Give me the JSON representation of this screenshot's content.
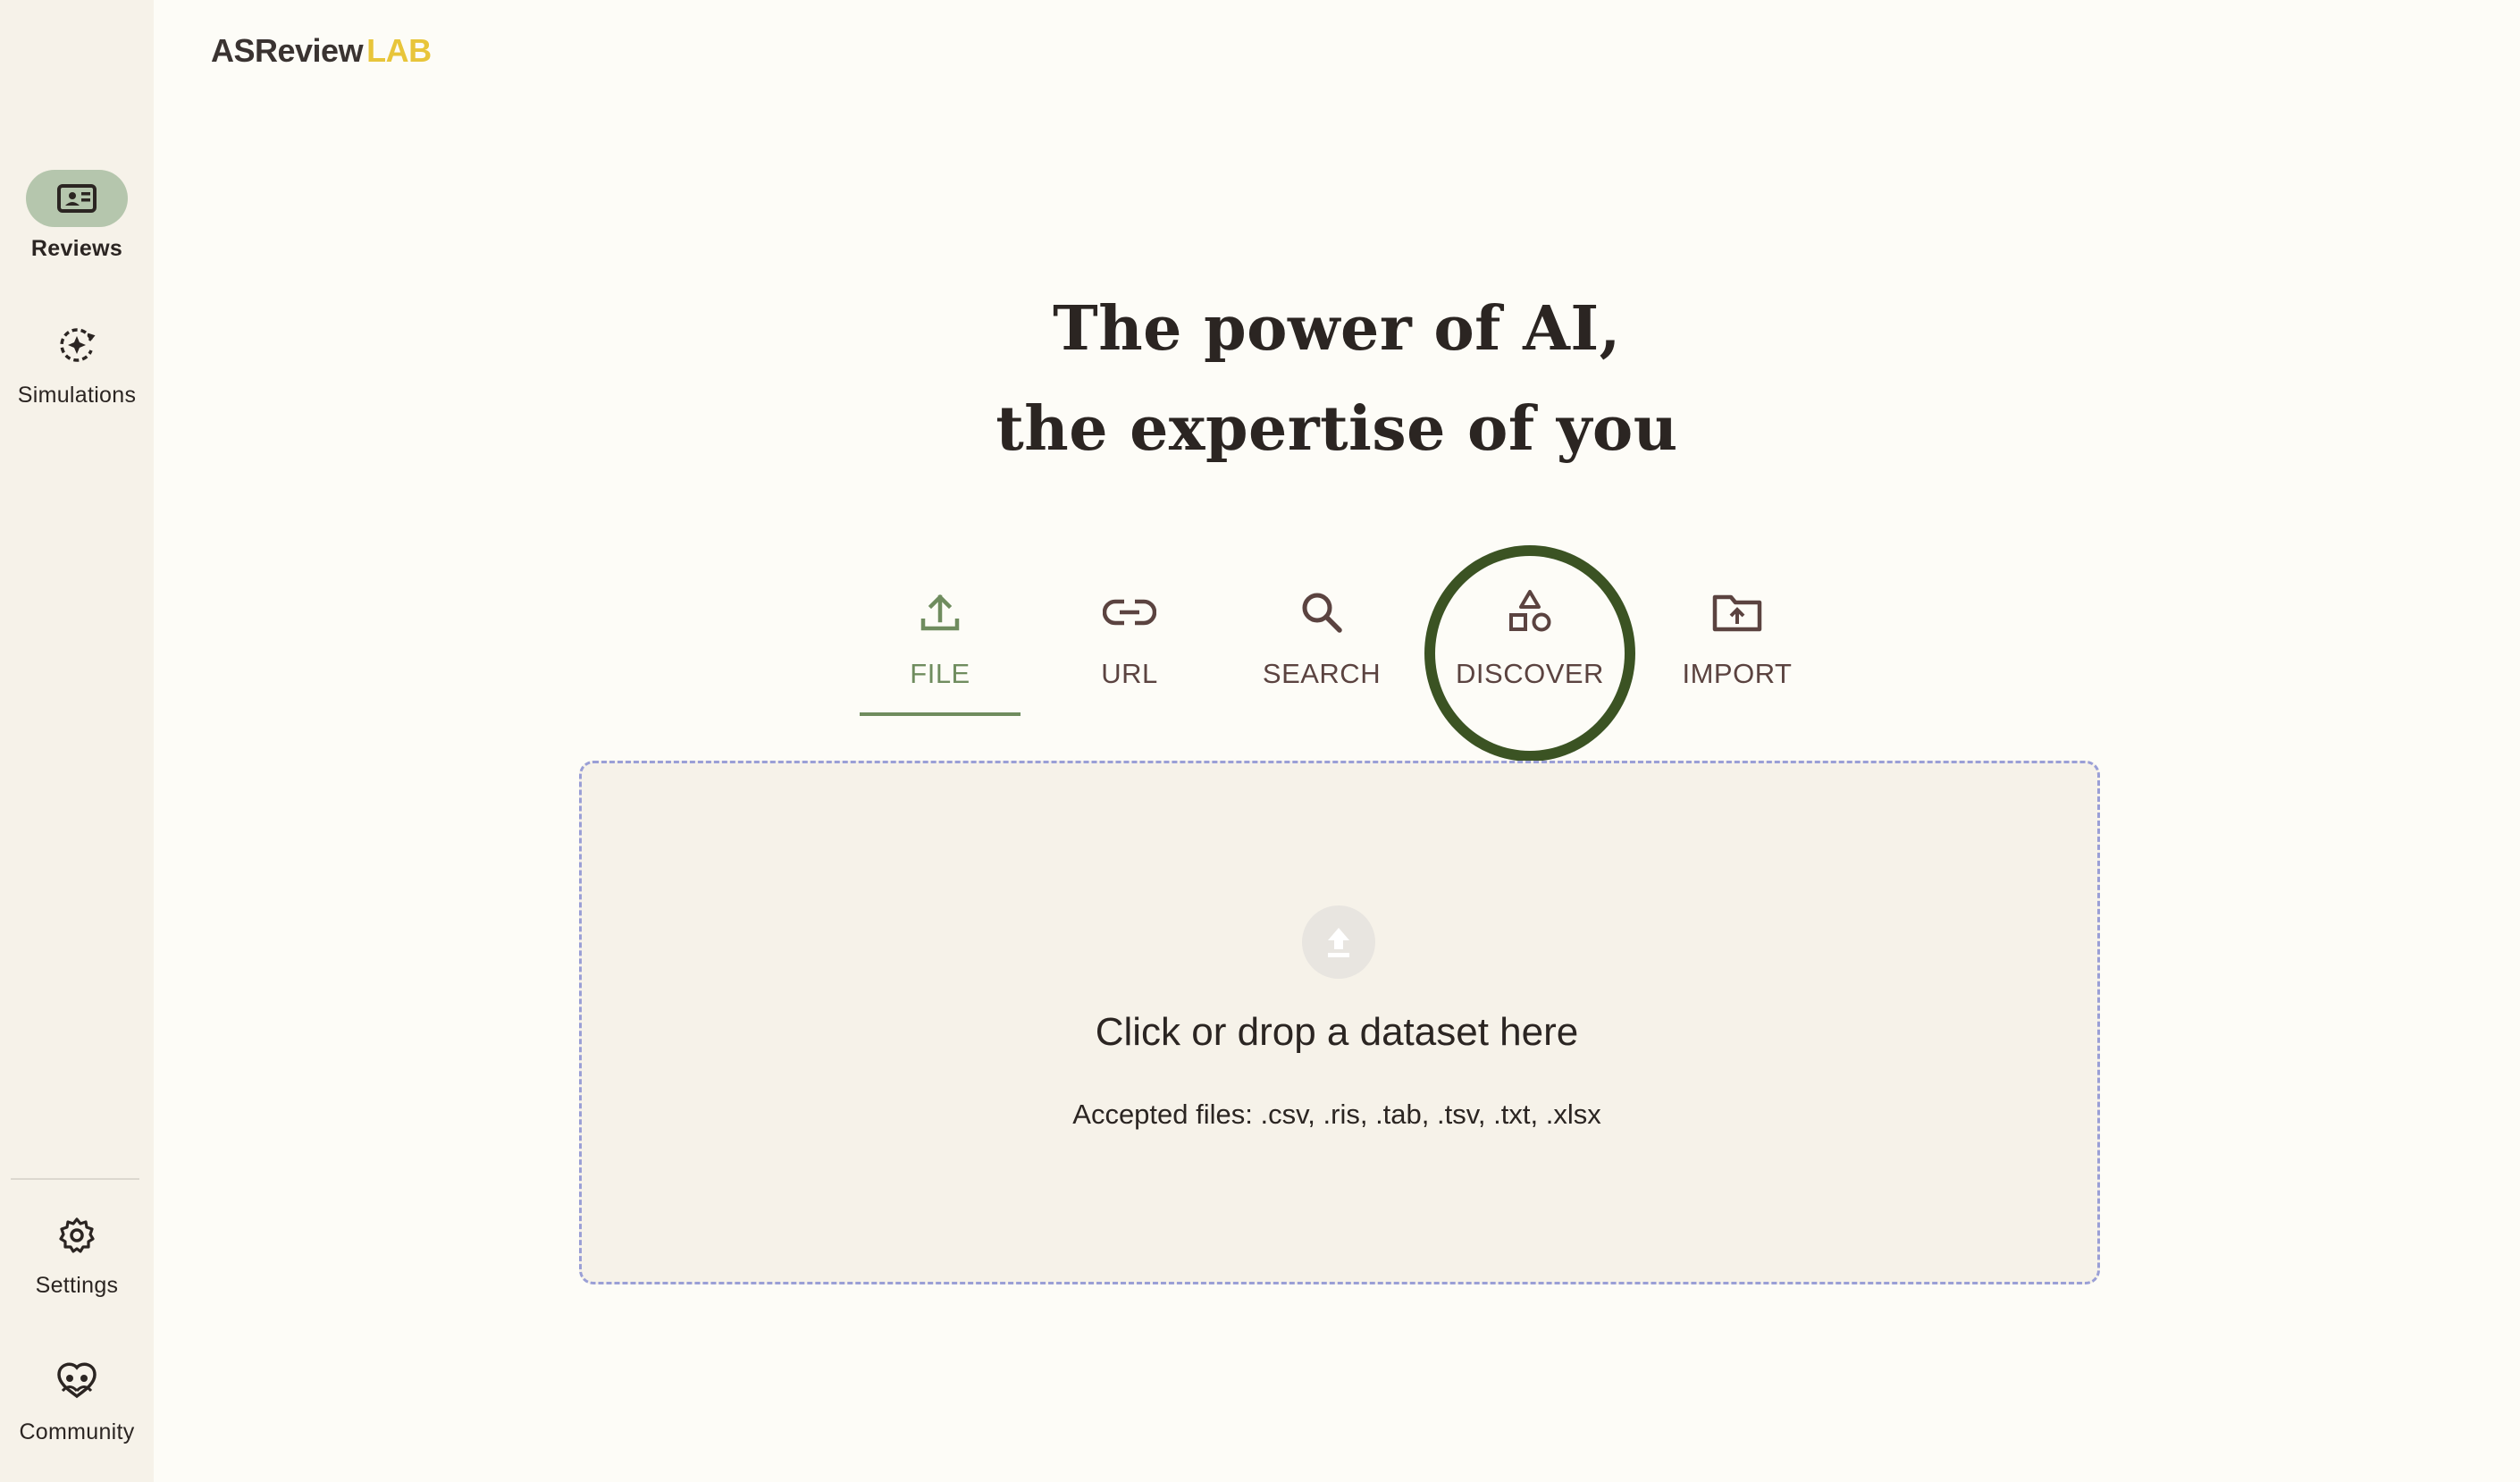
{
  "logo": {
    "brand": "ASReview",
    "suffix": "LAB"
  },
  "sidebar": {
    "items": [
      {
        "label": "Reviews",
        "icon": "reviews-icon",
        "active": true
      },
      {
        "label": "Simulations",
        "icon": "simulations-icon",
        "active": false
      }
    ],
    "bottom_items": [
      {
        "label": "Settings",
        "icon": "gear-icon"
      },
      {
        "label": "Community",
        "icon": "community-icon"
      }
    ]
  },
  "headline": {
    "line1": "The power of AI,",
    "line2": "the expertise of you"
  },
  "tabs": [
    {
      "label": "FILE",
      "icon": "upload-icon",
      "active": true
    },
    {
      "label": "URL",
      "icon": "link-icon",
      "active": false
    },
    {
      "label": "SEARCH",
      "icon": "search-icon",
      "active": false
    },
    {
      "label": "DISCOVER",
      "icon": "shapes-icon",
      "active": false,
      "highlighted": true
    },
    {
      "label": "IMPORT",
      "icon": "folder-upload-icon",
      "active": false
    }
  ],
  "dropzone": {
    "title": "Click or drop a dataset here",
    "subtitle": "Accepted files: .csv, .ris, .tab, .tsv, .txt, .xlsx"
  },
  "colors": {
    "accent": "#6f8c5e",
    "highlight_ring": "#3b5323",
    "logo_lab": "#e8c53a",
    "sidebar_bg": "#f6f2e9",
    "active_nav_bg": "#b5c6ad"
  }
}
